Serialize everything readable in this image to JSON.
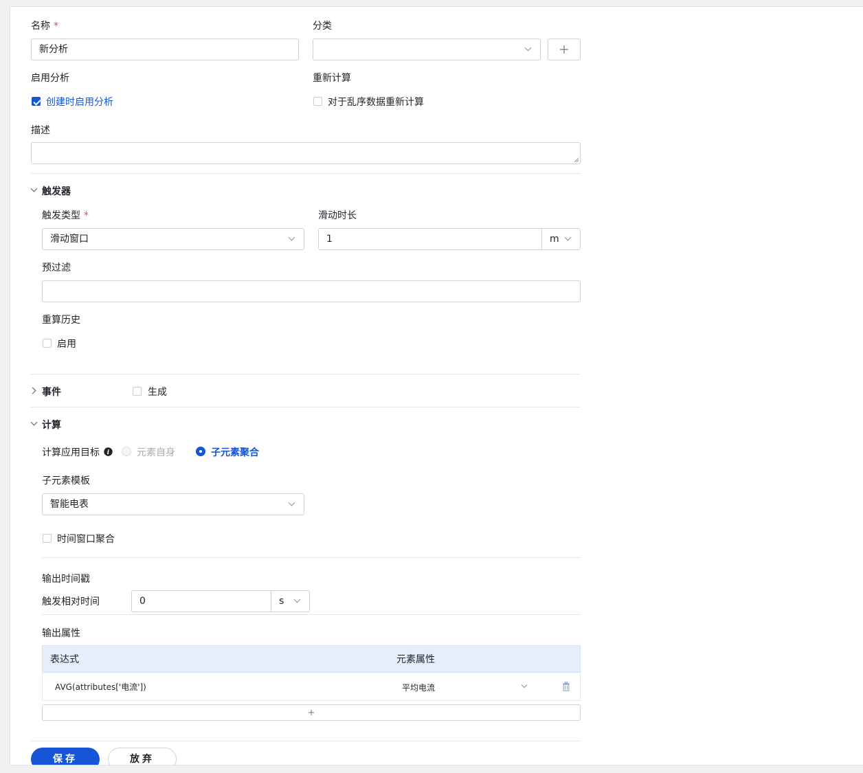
{
  "form": {
    "name_label": "名称",
    "required_mark": "*",
    "name_value": "新分析",
    "category_label": "分类",
    "category_value": "",
    "add_category_icon": "plus-icon",
    "enable_label": "启用分析",
    "enable_checkbox_label": "创建时启用分析",
    "enable_checked": true,
    "recalc_label": "重新计算",
    "recalc_checkbox_label": "对于乱序数据重新计算",
    "recalc_checked": false,
    "description_label": "描述",
    "description_value": ""
  },
  "trigger": {
    "section_title": "触发器",
    "type_label": "触发类型",
    "type_value": "滑动窗口",
    "sliding_label": "滑动时长",
    "sliding_value": "1",
    "sliding_unit": "m",
    "prefilter_label": "预过滤",
    "prefilter_value": "",
    "history_label": "重算历史",
    "history_checkbox_label": "启用",
    "history_checked": false
  },
  "event": {
    "section_title": "事件",
    "generate_label": "生成",
    "generate_checked": false
  },
  "calc": {
    "section_title": "计算",
    "target_label": "计算应用目标",
    "info_icon": "info-icon",
    "option_self": "元素自身",
    "option_child": "子元素聚合",
    "selected_option": "子元素聚合",
    "template_label": "子元素模板",
    "template_value": "智能电表",
    "window_agg_label": "时间窗口聚合",
    "window_agg_checked": false,
    "output_ts_label": "输出时间戳",
    "relative_time_label": "触发相对时间",
    "relative_time_value": "0",
    "relative_time_unit": "s",
    "output_attr_label": "输出属性",
    "table": {
      "columns": [
        "表达式",
        "元素属性"
      ],
      "rows": [
        {
          "expression": "AVG(attributes['电流'])",
          "attribute": "平均电流"
        }
      ]
    },
    "add_row_icon": "plus-icon",
    "delete_icon": "trash-icon"
  },
  "actions": {
    "save_label": "保存",
    "discard_label": "放弃"
  },
  "colors": {
    "primary": "#1656d6",
    "required": "#e5484d",
    "table_header": "#e6eefc"
  }
}
